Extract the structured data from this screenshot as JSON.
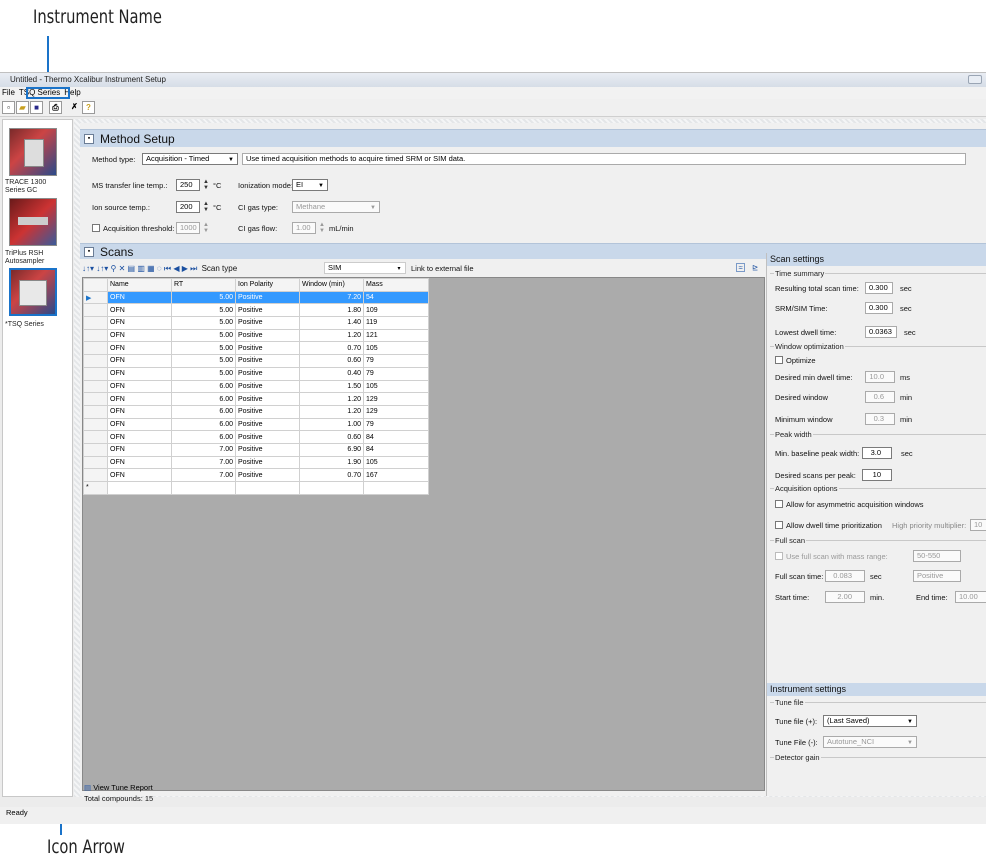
{
  "callouts": {
    "top": "Instrument Name",
    "bottom": "Icon Arrow"
  },
  "window": {
    "title": "Untitled - Thermo Xcalibur Instrument Setup"
  },
  "menu": [
    "File",
    "TSQ Series",
    "Help"
  ],
  "toolbar": {
    "icons": [
      "new-icon",
      "open-icon",
      "save-icon",
      "print-icon",
      "cut-icon",
      "help-icon"
    ]
  },
  "sidebar": {
    "instruments": [
      {
        "label": "TRACE 1300 Series GC"
      },
      {
        "label": "TriPlus RSH Autosampler"
      },
      {
        "label": "*TSQ Series"
      }
    ]
  },
  "method_setup": {
    "title": "Method Setup",
    "method_type_label": "Method type:",
    "method_type": "Acquisition - Timed",
    "method_desc": "Use timed acquisition methods to acquire timed SRM or SIM data.",
    "ms_transfer_label": "MS transfer line temp.:",
    "ms_transfer_value": "250",
    "ion_source_label": "Ion source temp.:",
    "ion_source_value": "200",
    "unit_c": "°C",
    "acq_threshold_label": "Acquisition threshold:",
    "acq_threshold_value": "1000",
    "ionization_label": "Ionization mode:",
    "ionization_value": "EI",
    "ci_gas_type_label": "CI gas type:",
    "ci_gas_type_value": "Methane",
    "ci_gas_flow_label": "CI gas flow:",
    "ci_gas_flow_value": "1.00",
    "ci_gas_flow_unit": "mL/min"
  },
  "scans": {
    "title": "Scans",
    "scan_type_label": "Scan type",
    "scan_type_value": "SIM",
    "link_label": "Link to external file",
    "columns": [
      "Name",
      "RT",
      "Ion Polarity",
      "Window (min)",
      "Mass"
    ],
    "rows": [
      [
        "OFN",
        "5.00",
        "Positive",
        "7.20",
        "54"
      ],
      [
        "OFN",
        "5.00",
        "Positive",
        "1.80",
        "109"
      ],
      [
        "OFN",
        "5.00",
        "Positive",
        "1.40",
        "119"
      ],
      [
        "OFN",
        "5.00",
        "Positive",
        "1.20",
        "121"
      ],
      [
        "OFN",
        "5.00",
        "Positive",
        "0.70",
        "105"
      ],
      [
        "OFN",
        "5.00",
        "Positive",
        "0.60",
        "79"
      ],
      [
        "OFN",
        "5.00",
        "Positive",
        "0.40",
        "79"
      ],
      [
        "OFN",
        "6.00",
        "Positive",
        "1.50",
        "105"
      ],
      [
        "OFN",
        "6.00",
        "Positive",
        "1.20",
        "129"
      ],
      [
        "OFN",
        "6.00",
        "Positive",
        "1.20",
        "129"
      ],
      [
        "OFN",
        "6.00",
        "Positive",
        "1.00",
        "79"
      ],
      [
        "OFN",
        "6.00",
        "Positive",
        "0.60",
        "84"
      ],
      [
        "OFN",
        "7.00",
        "Positive",
        "6.90",
        "84"
      ],
      [
        "OFN",
        "7.00",
        "Positive",
        "1.90",
        "105"
      ],
      [
        "OFN",
        "7.00",
        "Positive",
        "0.70",
        "167"
      ]
    ],
    "new_row_marker": "*",
    "total_compounds": "Total compounds: 15",
    "view_tune_report": "View Tune Report"
  },
  "scan_settings": {
    "title": "Scan settings",
    "time_summary": "Time summary",
    "total_scan_time_label": "Resulting total scan time:",
    "total_scan_time": "0.300",
    "srm_sim_label": "SRM/SIM Time:",
    "srm_sim": "0.300",
    "lowest_dwell_label": "Lowest dwell time:",
    "lowest_dwell": "0.0363",
    "sec": "sec",
    "window_opt": "Window optimization",
    "optimize": "Optimize",
    "min_dwell_label": "Desired min dwell time:",
    "min_dwell": "10.0",
    "ms": "ms",
    "desired_window_label": "Desired window",
    "desired_window": "0.6",
    "min": "min",
    "minimum_window_label": "Minimum window",
    "minimum_window": "0.3",
    "peak_width": "Peak width",
    "min_baseline_label": "Min. baseline peak width:",
    "min_baseline": "3.0",
    "scans_per_peak_label": "Desired scans per peak:",
    "scans_per_peak": "10",
    "acq_options": "Acquisition options",
    "asym_label": "Allow for asymmetric acquisition windows",
    "dwell_prior_label": "Allow dwell time prioritization",
    "high_priority_label": "High priority multiplier:",
    "high_priority": "10",
    "full_scan": "Full scan",
    "use_full_scan_label": "Use full scan with mass range:",
    "mass_range": "50-550",
    "full_scan_time_label": "Full scan time:",
    "full_scan_time": "0.083",
    "polarity": "Positive",
    "start_time_label": "Start time:",
    "start_time": "2.00",
    "min_dot": "min.",
    "end_time_label": "End time:",
    "end_time": "10.00"
  },
  "instrument_settings": {
    "title": "Instrument settings",
    "tune_file": "Tune file",
    "tune_plus_label": "Tune file (+):",
    "tune_plus": "(Last Saved)",
    "tune_minus_label": "Tune File (-):",
    "tune_minus": "Autotune_NCI",
    "detector_gain": "Detector gain"
  },
  "status": {
    "text": "Ready"
  }
}
